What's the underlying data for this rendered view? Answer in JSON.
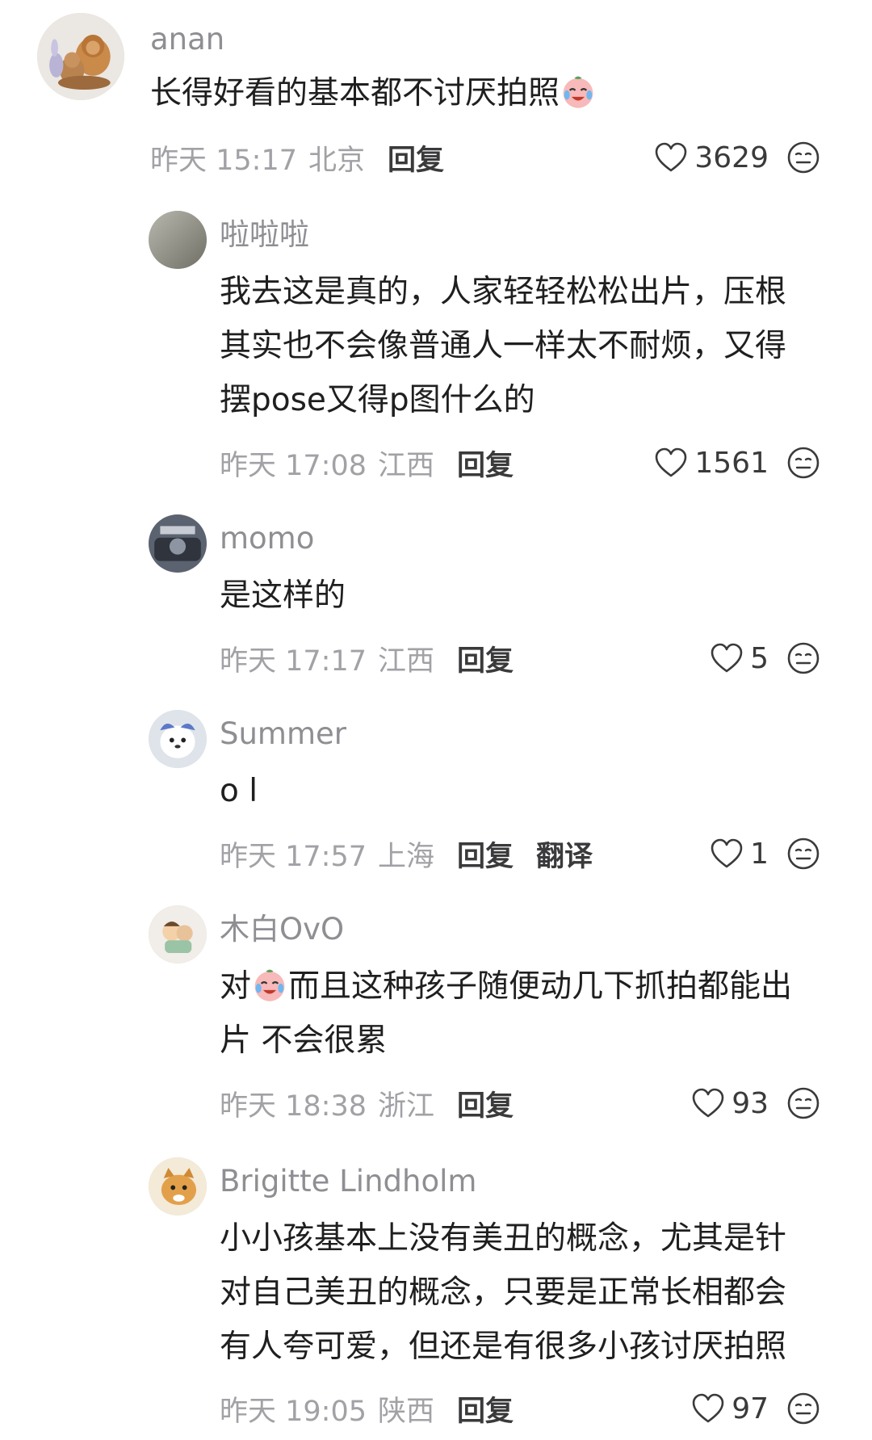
{
  "comments": [
    {
      "username": "anan",
      "content_lines": [
        "长得好看的基本都不讨厌拍照"
      ],
      "time": "昨天 15:17",
      "location": "北京",
      "reply_label": "回复",
      "likes": "3629"
    },
    {
      "username": "啦啦啦",
      "content_lines": [
        "我去这是真的，人家轻轻松松出片，压根",
        "其实也不会像普通人一样太不耐烦，又得",
        "摆pose又得p图什么的"
      ],
      "time": "昨天 17:08",
      "location": "江西",
      "reply_label": "回复",
      "likes": "1561"
    },
    {
      "username": "momo",
      "content_lines": [
        "是这样的"
      ],
      "time": "昨天 17:17",
      "location": "江西",
      "reply_label": "回复",
      "likes": "5"
    },
    {
      "username": "Summer",
      "content_lines": [
        "o l"
      ],
      "time": "昨天 17:57",
      "location": "上海",
      "reply_label": "回复",
      "translate_label": "翻译",
      "likes": "1"
    },
    {
      "username": "木白OvO",
      "content_prefix": "对",
      "content_line1_rest": "而且这种孩子随便动几下抓拍都能出",
      "content_line2": "片 不会很累",
      "time": "昨天 18:38",
      "location": "浙江",
      "reply_label": "回复",
      "likes": "93"
    },
    {
      "username": "Brigitte Lindholm",
      "content_lines": [
        "小小孩基本上没有美丑的概念，尤其是针",
        "对自己美丑的概念，只要是正常长相都会",
        "有人夸可爱，但还是有很多小孩讨厌拍照"
      ],
      "time": "昨天 19:05",
      "location": "陕西",
      "reply_label": "回复",
      "likes": "97"
    }
  ],
  "icons": {
    "like": "heart-outline-icon",
    "reaction": "neutral-face-icon",
    "emoji": "crying-laughing-emoji"
  },
  "colors": {
    "meta_gray": "#a1a1a6",
    "username_gray": "#8e8e93",
    "text": "#1f1f1f",
    "action": "#3a3a3c"
  }
}
